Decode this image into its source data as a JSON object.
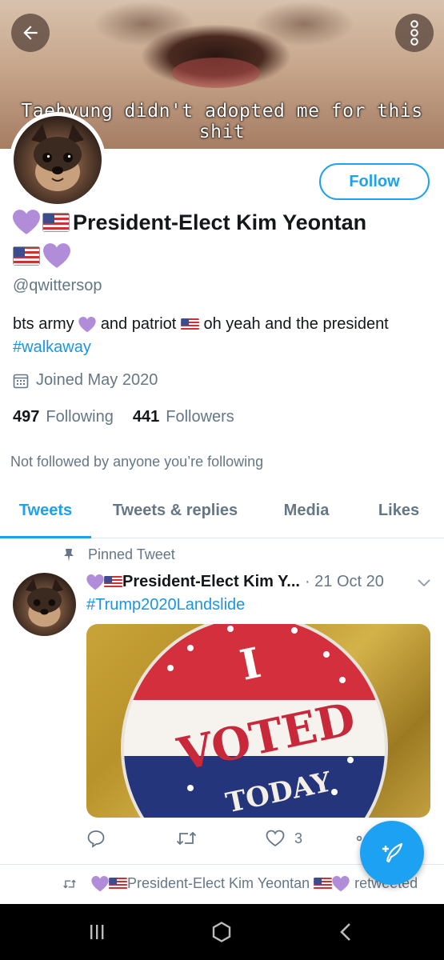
{
  "banner": {
    "caption": "Taehyung didn't adopted me for this shit"
  },
  "profile": {
    "follow_label": "Follow",
    "name": "President-Elect Kim Yeontan",
    "handle": "@qwittersop",
    "bio": {
      "part1": "bts army",
      "part2": "and patriot",
      "part3": "oh yeah and the president",
      "hashtag": "#walkaway"
    },
    "joined": "Joined May 2020",
    "following_count": "497",
    "following_label": "Following",
    "followers_count": "441",
    "followers_label": "Followers",
    "not_followed": "Not followed by anyone you’re following"
  },
  "tabs": [
    {
      "label": "Tweets",
      "active": true
    },
    {
      "label": "Tweets & replies",
      "active": false
    },
    {
      "label": "Media",
      "active": false
    },
    {
      "label": "Likes",
      "active": false
    }
  ],
  "tweet": {
    "pinned_label": "Pinned Tweet",
    "author": "President-Elect Kim Y...",
    "date": "· 21 Oct 20",
    "text": "#Trump2020Landslide",
    "image_text": {
      "line1": "I",
      "line2": "VOTED",
      "line3": "TODAY"
    },
    "like_count": "3"
  },
  "retweet": {
    "name": "President-Elect Kim Yeontan",
    "suffix": "retweeted"
  },
  "colors": {
    "accent": "#1da1f2",
    "heart": "#b18cd9",
    "secondary_text": "#657786"
  },
  "icons": [
    "back-arrow-icon",
    "more-vertical-icon",
    "calendar-icon",
    "pin-icon",
    "chevron-down-icon",
    "reply-icon",
    "retweet-icon",
    "like-icon",
    "share-icon",
    "compose-tweet-icon",
    "recent-apps-icon",
    "home-icon",
    "back-icon"
  ]
}
